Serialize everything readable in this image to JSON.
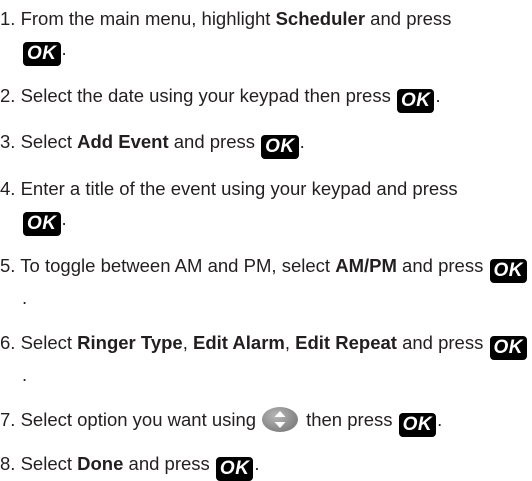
{
  "ok_key": "OK",
  "steps": [
    {
      "number": "1.",
      "parts": [
        "From the main menu, highlight ",
        "Scheduler",
        " and press",
        "."
      ]
    },
    {
      "number": "2.",
      "parts": [
        "Select the date using your keypad then press",
        "."
      ]
    },
    {
      "number": "3.",
      "parts": [
        "Select ",
        "Add Event",
        " and press",
        "."
      ]
    },
    {
      "number": "4.",
      "parts": [
        "Enter a title of the event using your keypad and press",
        "."
      ]
    },
    {
      "number": "5.",
      "parts": [
        "To toggle between AM and PM, select ",
        "AM/PM",
        " and press",
        "."
      ]
    },
    {
      "number": "6.",
      "parts": [
        "Select ",
        "Ringer Type",
        ", ",
        "Edit Alarm",
        ", ",
        "Edit Repeat",
        " and press",
        "."
      ]
    },
    {
      "number": "7.",
      "parts": [
        "Select option you want using",
        "then press",
        "."
      ]
    },
    {
      "number": "8.",
      "parts": [
        "Select ",
        "Done",
        " and press",
        "."
      ]
    }
  ],
  "icons": {
    "ok_button": "ok-key-icon",
    "navigation": "up-down-navigation-key-icon"
  },
  "colors": {
    "text": "#231f20",
    "ok_key_background": "#000000",
    "ok_key_text": "#ffffff",
    "nav_key": "#8d8d8d"
  }
}
